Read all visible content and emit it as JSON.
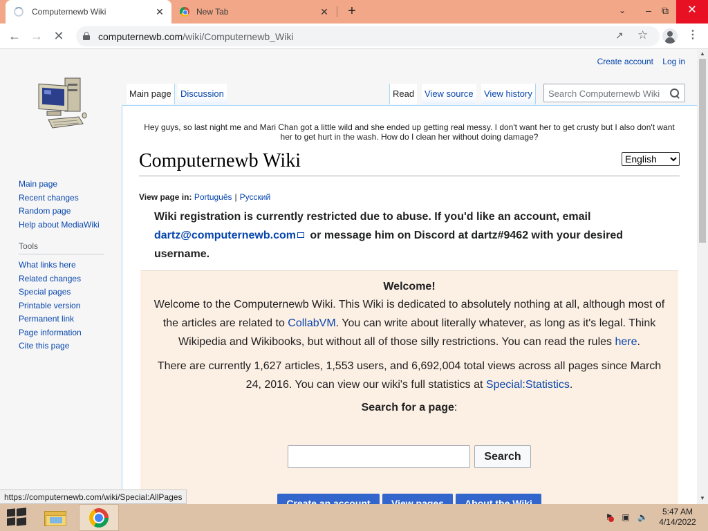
{
  "browser": {
    "tabs": [
      {
        "title": "Computernewb Wiki",
        "close": "✕"
      },
      {
        "title": "New Tab",
        "close": "✕"
      }
    ],
    "new_tab": "+",
    "url_host": "computernewb.com",
    "url_path": "/wiki/Computernewb_Wiki"
  },
  "wiki": {
    "personal": {
      "create_account": "Create account",
      "log_in": "Log in"
    },
    "tabs": {
      "main_page": "Main page",
      "discussion": "Discussion",
      "read": "Read",
      "view_source": "View source",
      "view_history": "View history"
    },
    "search_placeholder": "Search Computernewb Wiki",
    "navigation": [
      "Main page",
      "Recent changes",
      "Random page",
      "Help about MediaWiki"
    ],
    "tools_heading": "Tools",
    "tools": [
      "What links here",
      "Related changes",
      "Special pages",
      "Printable version",
      "Permanent link",
      "Page information",
      "Cite this page"
    ],
    "sitenotice": "Hey guys, so last night me and Mari Chan got a little wild and she ended up getting real messy. I don't want her to get crusty but I also don't want her to get hurt in the wash. How do I clean her without doing damage?",
    "heading": "Computernewb Wiki",
    "language": "English",
    "view_page_in_label": "View page in:",
    "languages": [
      "Português",
      "Русский"
    ],
    "lang_sep": "|",
    "notice": {
      "part1": "Wiki registration is currently restricted due to abuse. If you'd like an account, email",
      "email": "dartz@computernewb.com",
      "part2": "or message him on Discord at dartz#9462 with your desired username."
    },
    "welcome": {
      "title": "Welcome!",
      "p1_a": "Welcome to the Computernewb Wiki. This Wiki is dedicated to absolutely nothing at all, although most of the articles are related to",
      "p1_link": "CollabVM",
      "p1_b": ". You can write about literally whatever, as long as it's legal. Think Wikipedia and Wikibooks, but without all of those silly restrictions. You can read the rules",
      "p1_link2": "here",
      "p1_c": ".",
      "p2_a": "There are currently 1,627 articles, 1,553 users, and 6,692,004 total views across all pages since March 24, 2016. You can view our wiki's full statistics at",
      "p2_link": "Special:Statistics",
      "p2_b": ".",
      "search_label": "Search for a page",
      "search_colon": ":",
      "search_button": "Search",
      "buttons": [
        "Create an account",
        "View pages",
        "About the Wiki"
      ]
    },
    "status_url": "https://computernewb.com/wiki/Special:AllPages"
  },
  "taskbar": {
    "time": "5:47 AM",
    "date": "4/14/2022"
  }
}
